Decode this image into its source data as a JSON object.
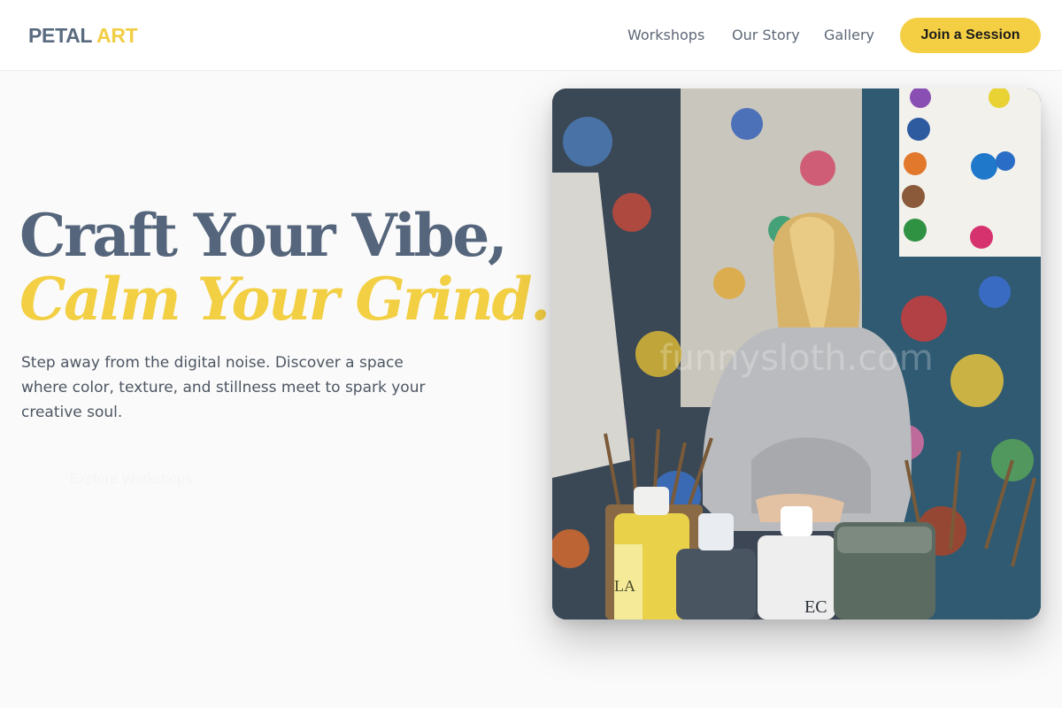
{
  "brand": {
    "part1": "PETAL",
    "part2": "ART"
  },
  "nav": {
    "links": [
      "Workshops",
      "Our Story",
      "Gallery"
    ],
    "cta_label": "Join a Session"
  },
  "hero": {
    "headline_line1": "Craft Your Vibe,",
    "headline_line2": "Calm Your Grind.",
    "description": "Step away from the digital noise. Discover a space where color, texture, and stillness meet to spark your creative soul.",
    "secondary_button": "Explore Workshops"
  },
  "image": {
    "watermark": "funnysloth.com",
    "jar_label": "EC",
    "yellow_bottle_label": "LA"
  },
  "colors": {
    "accent": "#f5cf43",
    "slate": "#55657b",
    "background": "#fafafa"
  }
}
